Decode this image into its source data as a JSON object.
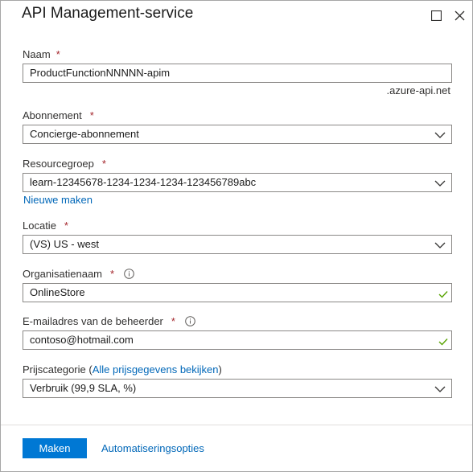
{
  "header": {
    "title": "API Management-service"
  },
  "form": {
    "name": {
      "label": "Naam",
      "required": "*",
      "value": "ProductFunctionNNNNN-apim",
      "suffix": ".azure-api.net"
    },
    "subscription": {
      "label": "Abonnement",
      "required": "*",
      "value": "Concierge-abonnement"
    },
    "resource_group": {
      "label": "Resourcegroep",
      "required": "*",
      "value": "learn-12345678-1234-1234-1234-123456789abc",
      "create_new": "Nieuwe maken"
    },
    "location": {
      "label": "Locatie",
      "required": "*",
      "value": "(VS) US - west"
    },
    "org_name": {
      "label": "Organisatienaam",
      "required": "*",
      "value": "OnlineStore"
    },
    "admin_email": {
      "label": "E-mailadres van de beheerder",
      "required": "*",
      "value": "contoso@hotmail.com"
    },
    "pricing": {
      "label_prefix": "Prijscategorie (",
      "label_link": "Alle prijsgegevens bekijken",
      "label_suffix": ")",
      "value": "Verbruik (99,9 SLA, %)"
    }
  },
  "footer": {
    "create_label": "Maken",
    "automation_label": "Automatiseringsopties"
  },
  "colors": {
    "accent": "#0078d4",
    "link": "#0067b8",
    "required": "#a4262c",
    "valid": "#57a300"
  }
}
